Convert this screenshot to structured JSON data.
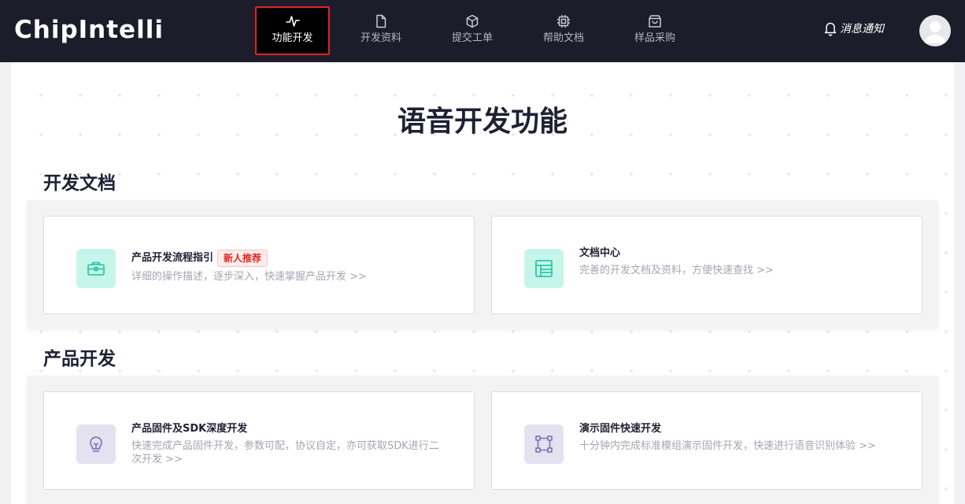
{
  "header": {
    "logo": "ChipIntelli",
    "nav": [
      {
        "label": "功能开发",
        "icon": "activity-icon",
        "active": true
      },
      {
        "label": "开发资料",
        "icon": "file-icon",
        "active": false
      },
      {
        "label": "提交工单",
        "icon": "box-icon",
        "active": false
      },
      {
        "label": "帮助文档",
        "icon": "cpu-icon",
        "active": false
      },
      {
        "label": "样品采购",
        "icon": "shopping-bag-icon",
        "active": false
      }
    ],
    "notify_label": "消息通知"
  },
  "main": {
    "title": "语音开发功能",
    "sections": [
      {
        "title": "开发文档",
        "cards": [
          {
            "title": "产品开发流程指引",
            "badge": "新人推荐",
            "desc": "详细的操作描述，逐步深入，快速掌握产品开发 >>",
            "icon": "toolbox-icon"
          },
          {
            "title": "文档中心",
            "desc": "完善的开发文档及资料，方便快速查找 >>",
            "icon": "layout-icon"
          }
        ]
      },
      {
        "title": "产品开发",
        "cards": [
          {
            "title": "产品固件及SDK深度开发",
            "desc": "快速完成产品固件开发，参数可配，协议自定，亦可获取SDK进行二次开发 >>",
            "icon": "lightbulb-icon"
          },
          {
            "title": "演示固件快速开发",
            "desc": "十分钟内完成标准模组演示固件开发，快速进行语音识别体验 >>",
            "icon": "frame-icon"
          }
        ]
      }
    ]
  },
  "colors": {
    "topbar": "#1c1c2a",
    "active_border": "#e0261f",
    "badge_text": "#e0261f",
    "icon_green_bg": "#c6f5ea",
    "icon_purple_bg": "#e4e2f1"
  }
}
